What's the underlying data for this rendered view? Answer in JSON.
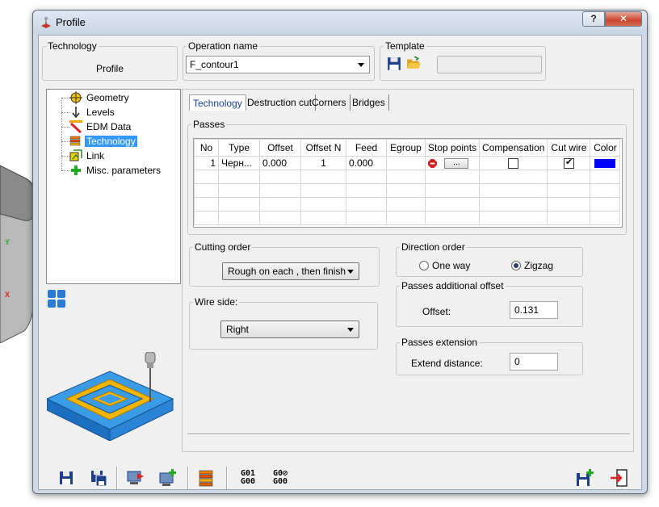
{
  "window": {
    "title": "Profile",
    "help_label": "?",
    "close_label": "✕"
  },
  "background": {
    "axis_y": "Y",
    "axis_x": "X"
  },
  "technology_box": {
    "legend": "Technology",
    "value": "Profile"
  },
  "operation": {
    "legend": "Operation name",
    "value": "F_contour1"
  },
  "template": {
    "legend": "Template",
    "value": ""
  },
  "tree": {
    "items": [
      {
        "label": "Geometry",
        "icon": "geometry-target-icon"
      },
      {
        "label": "Levels",
        "icon": "levels-arrow-icon"
      },
      {
        "label": "EDM Data",
        "icon": "edm-wire-icon"
      },
      {
        "label": "Technology",
        "icon": "technology-stack-icon",
        "selected": true
      },
      {
        "label": "Link",
        "icon": "link-icon"
      },
      {
        "label": "Misc. parameters",
        "icon": "plus-icon"
      }
    ]
  },
  "tabs": [
    {
      "label": "Technology",
      "active": true
    },
    {
      "label": "Destruction cut"
    },
    {
      "label": "Corners"
    },
    {
      "label": "Bridges"
    }
  ],
  "passes": {
    "legend": "Passes",
    "columns": [
      "No",
      "Type",
      "Offset",
      "Offset N",
      "Feed",
      "Egroup",
      "Stop points",
      "Compensation",
      "Cut wire",
      "Color"
    ],
    "rows": [
      {
        "no": "1",
        "type": "Черн...",
        "offset": "0.000",
        "offset_n": "1",
        "feed": "0.000",
        "egroup": "",
        "stop_points": "...",
        "compensation": false,
        "cut_wire": true,
        "color": "#0000ff"
      }
    ]
  },
  "cutting_order": {
    "legend": "Cutting order",
    "value": "Rough on each , then finish"
  },
  "wire_side": {
    "legend": "Wire side:",
    "value": "Right"
  },
  "direction_order": {
    "legend": "Direction order",
    "options": [
      {
        "label": "One way",
        "selected": false
      },
      {
        "label": "Zigzag",
        "selected": true
      }
    ]
  },
  "passes_offset": {
    "legend": "Passes additional offset",
    "label": "Offset:",
    "value": "0.131"
  },
  "passes_extension": {
    "legend": "Passes extension",
    "label": "Extend distance:",
    "value": "0"
  },
  "toolbar": {
    "gcode1_top": "G01",
    "gcode1_bottom": "G00",
    "gcode2_top": "G0⊘",
    "gcode2_bottom": "G00"
  }
}
